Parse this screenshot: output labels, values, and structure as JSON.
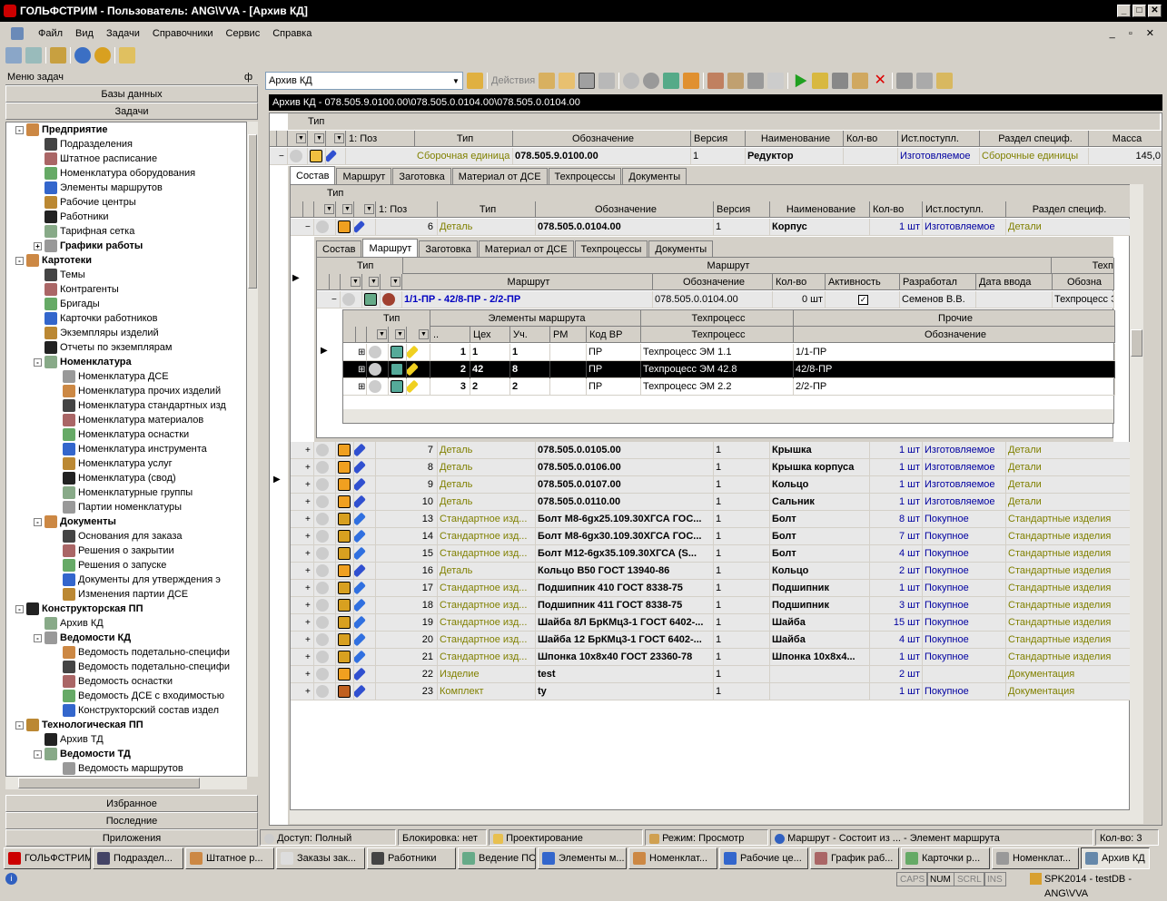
{
  "window": {
    "title": "ГОЛЬФСТРИМ - Пользователь: ANG\\VVA - [Архив КД]",
    "mdi": "_ ▫ ✕"
  },
  "menu": [
    "Файл",
    "Вид",
    "Задачи",
    "Справочники",
    "Сервис",
    "Справка"
  ],
  "left": {
    "header": "Меню задач",
    "pin": "ф",
    "sections_top": [
      "Базы данных",
      "Задачи"
    ],
    "sections_bottom": [
      "Избранное",
      "Последние",
      "Приложения"
    ]
  },
  "tree": [
    {
      "t": "Предприятие",
      "lvl": 1,
      "b": true,
      "pm": "-"
    },
    {
      "t": "Подразделения",
      "lvl": 2
    },
    {
      "t": "Штатное расписание",
      "lvl": 2
    },
    {
      "t": "Номенклатура оборудования",
      "lvl": 2
    },
    {
      "t": "Элементы маршрутов",
      "lvl": 2
    },
    {
      "t": "Рабочие центры",
      "lvl": 2
    },
    {
      "t": "Работники",
      "lvl": 2
    },
    {
      "t": "Тарифная сетка",
      "lvl": 2
    },
    {
      "t": "Графики работы",
      "lvl": 2,
      "b": true,
      "pm": "+"
    },
    {
      "t": "Картотеки",
      "lvl": 1,
      "b": true,
      "pm": "-"
    },
    {
      "t": "Темы",
      "lvl": 2
    },
    {
      "t": "Контрагенты",
      "lvl": 2
    },
    {
      "t": "Бригады",
      "lvl": 2
    },
    {
      "t": "Карточки работников",
      "lvl": 2
    },
    {
      "t": "Экземпляры изделий",
      "lvl": 2
    },
    {
      "t": "Отчеты по экземплярам",
      "lvl": 2
    },
    {
      "t": "Номенклатура",
      "lvl": 2,
      "b": true,
      "pm": "-"
    },
    {
      "t": "Номенклатура ДСЕ",
      "lvl": 3
    },
    {
      "t": "Номенклатура прочих изделий",
      "lvl": 3
    },
    {
      "t": "Номенклатура стандартных изд",
      "lvl": 3
    },
    {
      "t": "Номенклатура материалов",
      "lvl": 3
    },
    {
      "t": "Номенклатура оснастки",
      "lvl": 3
    },
    {
      "t": "Номенклатура инструмента",
      "lvl": 3
    },
    {
      "t": "Номенклатура услуг",
      "lvl": 3
    },
    {
      "t": "Номенклатура (свод)",
      "lvl": 3
    },
    {
      "t": "Номенклатурные группы",
      "lvl": 3
    },
    {
      "t": "Партии номенклатуры",
      "lvl": 3
    },
    {
      "t": "Документы",
      "lvl": 2,
      "b": true,
      "pm": "-"
    },
    {
      "t": "Основания для заказа",
      "lvl": 3
    },
    {
      "t": "Решения о закрытии",
      "lvl": 3
    },
    {
      "t": "Решения о запуске",
      "lvl": 3
    },
    {
      "t": "Документы для утверждения э",
      "lvl": 3
    },
    {
      "t": "Изменения партии ДСЕ",
      "lvl": 3
    },
    {
      "t": "Конструкторская ПП",
      "lvl": 1,
      "b": true,
      "pm": "-"
    },
    {
      "t": "Архив КД",
      "lvl": 2
    },
    {
      "t": "Ведомости КД",
      "lvl": 2,
      "b": true,
      "pm": "-"
    },
    {
      "t": "Ведомость подетально-специфи",
      "lvl": 3
    },
    {
      "t": "Ведомость подетально-специфи",
      "lvl": 3
    },
    {
      "t": "Ведомость оснастки",
      "lvl": 3
    },
    {
      "t": "Ведомость ДСЕ с входимостью",
      "lvl": 3
    },
    {
      "t": "Конструкторский состав издел",
      "lvl": 3
    },
    {
      "t": "Технологическая ПП",
      "lvl": 1,
      "b": true,
      "pm": "-"
    },
    {
      "t": "Архив ТД",
      "lvl": 2
    },
    {
      "t": "Ведомости ТД",
      "lvl": 2,
      "b": true,
      "pm": "-"
    },
    {
      "t": "Ведомость маршрутов",
      "lvl": 3
    }
  ],
  "toolbar2": {
    "combo": "Архив КД",
    "actions": "Действия"
  },
  "path": "Архив КД - 078.505.9.0100.00\\078.505.0.0104.00\\078.505.0.0104.00",
  "grid": {
    "group_label": "Тип",
    "cols": [
      "1: Поз",
      "Тип",
      "Обозначение",
      "Версия",
      "Наименование",
      "Кол-во",
      "Ист.поступл.",
      "Раздел специф.",
      "Масса"
    ],
    "root": {
      "type": "Сборочная единица",
      "code": "078.505.9.0100.00",
      "ver": "1",
      "name": "Редуктор",
      "src": "Изготовляемое",
      "sect": "Сборочные единицы",
      "mass": "145,0"
    },
    "tabs1": [
      "Состав",
      "Маршрут",
      "Заготовка",
      "Материал от ДСЕ",
      "Техпроцессы",
      "Документы"
    ],
    "sub": {
      "group_label": "Тип",
      "cols": [
        "1: Поз",
        "Тип",
        "Обозначение",
        "Версия",
        "Наименование",
        "Кол-во",
        "Ист.поступл.",
        "Раздел специф."
      ],
      "row": {
        "pos": "6",
        "type": "Деталь",
        "code": "078.505.0.0104.00",
        "ver": "1",
        "name": "Корпус",
        "qty": "1 шт",
        "src": "Изготовляемое",
        "sect": "Детали"
      }
    },
    "tabs2": [
      "Состав",
      "Маршрут",
      "Заготовка",
      "Материал от ДСЕ",
      "Техпроцессы",
      "Документы"
    ],
    "route": {
      "group_label": "Тип",
      "band": "Маршрут",
      "band2": "Техп",
      "cols": [
        "Маршрут",
        "Обозначение",
        "Кол-во",
        "Активность",
        "Разработал",
        "Дата ввода",
        "Обозна"
      ],
      "row": {
        "route": "1/1-ПР - 42/8-ПР - 2/2-ПР",
        "code": "078.505.0.0104.00",
        "qty": "0 шт",
        "check": "✓",
        "dev": "Семенов В.В.",
        "tp": "Техпроцесс Э"
      }
    },
    "elements": {
      "group_label": "Тип",
      "band1": "Элементы маршрута",
      "band2": "Техпроцесс",
      "band3": "Прочие",
      "cols": [
        "..",
        "Цех",
        "Уч.",
        "РМ",
        "Код ВР",
        "Техпроцесс",
        "Обозначение"
      ],
      "rows": [
        {
          "n": "1",
          "shop": "1",
          "area": "1",
          "rm": "",
          "vr": "ПР",
          "tp": "Техпроцесс ЭМ 1.1",
          "code": "1/1-ПР"
        },
        {
          "n": "2",
          "shop": "42",
          "area": "8",
          "rm": "",
          "vr": "ПР",
          "tp": "Техпроцесс ЭМ 42.8",
          "code": "42/8-ПР"
        },
        {
          "n": "3",
          "shop": "2",
          "area": "2",
          "rm": "",
          "vr": "ПР",
          "tp": "Техпроцесс ЭМ 2.2",
          "code": "2/2-ПР"
        }
      ]
    },
    "rows": [
      {
        "pos": "7",
        "type": "Деталь",
        "code": "078.505.0.0105.00",
        "ver": "1",
        "name": "Крышка",
        "qty": "1 шт",
        "src": "Изготовляемое",
        "sect": "Детали",
        "k": "d"
      },
      {
        "pos": "8",
        "type": "Деталь",
        "code": "078.505.0.0106.00",
        "ver": "1",
        "name": "Крышка корпуса",
        "qty": "1 шт",
        "src": "Изготовляемое",
        "sect": "Детали",
        "k": "d"
      },
      {
        "pos": "9",
        "type": "Деталь",
        "code": "078.505.0.0107.00",
        "ver": "1",
        "name": "Кольцо",
        "qty": "1 шт",
        "src": "Изготовляемое",
        "sect": "Детали",
        "k": "d"
      },
      {
        "pos": "10",
        "type": "Деталь",
        "code": "078.505.0.0110.00",
        "ver": "1",
        "name": "Сальник",
        "qty": "1 шт",
        "src": "Изготовляемое",
        "sect": "Детали",
        "k": "d"
      },
      {
        "pos": "13",
        "type": "Стандартное изд...",
        "code": "Болт М8-6gx25.109.30ХГСА ГОС...",
        "ver": "1",
        "name": "Болт",
        "qty": "8 шт",
        "src": "Покупное",
        "sect": "Стандартные изделия",
        "k": "s"
      },
      {
        "pos": "14",
        "type": "Стандартное изд...",
        "code": "Болт М8-6gx30.109.30ХГСА ГОС...",
        "ver": "1",
        "name": "Болт",
        "qty": "7 шт",
        "src": "Покупное",
        "sect": "Стандартные изделия",
        "k": "s"
      },
      {
        "pos": "15",
        "type": "Стандартное изд...",
        "code": "Болт М12-6gx35.109.30ХГСА (S...",
        "ver": "1",
        "name": "Болт",
        "qty": "4 шт",
        "src": "Покупное",
        "sect": "Стандартные изделия",
        "k": "s"
      },
      {
        "pos": "16",
        "type": "Деталь",
        "code": "Кольцо В50 ГОСТ 13940-86",
        "ver": "1",
        "name": "Кольцо",
        "qty": "2 шт",
        "src": "Покупное",
        "sect": "Стандартные изделия",
        "k": "d"
      },
      {
        "pos": "17",
        "type": "Стандартное изд...",
        "code": "Подшипник 410 ГОСТ 8338-75",
        "ver": "1",
        "name": "Подшипник",
        "qty": "1 шт",
        "src": "Покупное",
        "sect": "Стандартные изделия",
        "k": "s"
      },
      {
        "pos": "18",
        "type": "Стандартное изд...",
        "code": "Подшипник 411 ГОСТ 8338-75",
        "ver": "1",
        "name": "Подшипник",
        "qty": "3 шт",
        "src": "Покупное",
        "sect": "Стандартные изделия",
        "k": "s"
      },
      {
        "pos": "19",
        "type": "Стандартное изд...",
        "code": "Шайба 8Л БрКМц3-1 ГОСТ 6402-...",
        "ver": "1",
        "name": "Шайба",
        "qty": "15 шт",
        "src": "Покупное",
        "sect": "Стандартные изделия",
        "k": "s"
      },
      {
        "pos": "20",
        "type": "Стандартное изд...",
        "code": "Шайба 12 БрКМц3-1 ГОСТ 6402-...",
        "ver": "1",
        "name": "Шайба",
        "qty": "4 шт",
        "src": "Покупное",
        "sect": "Стандартные изделия",
        "k": "s"
      },
      {
        "pos": "21",
        "type": "Стандартное изд...",
        "code": "Шпонка 10х8х40 ГОСТ 23360-78",
        "ver": "1",
        "name": "Шпонка 10х8х4...",
        "qty": "1 шт",
        "src": "Покупное",
        "sect": "Стандартные изделия",
        "k": "s"
      },
      {
        "pos": "22",
        "type": "Изделие",
        "code": "test",
        "ver": "1",
        "name": "",
        "qty": "2 шт",
        "src": "",
        "sect": "Документация",
        "k": "i"
      },
      {
        "pos": "23",
        "type": "Комплект",
        "code": "ty",
        "ver": "1",
        "name": "",
        "qty": "1 шт",
        "src": "Покупное",
        "sect": "Документация",
        "k": "k"
      }
    ]
  },
  "status": [
    "Доступ: Полный",
    "Блокировка: нет",
    "Проектирование",
    "Режим: Просмотр",
    "Маршрут - Состоит из ... - Элемент маршрута",
    "Кол-во: 3"
  ],
  "tasks": [
    "ГОЛЬФСТРИМ",
    "Подраздел...",
    "Штатное р...",
    "Заказы зак...",
    "Работники",
    "Ведение ПСп",
    "Элементы м...",
    "Номенклат...",
    "Рабочие це...",
    "График раб...",
    "Карточки р...",
    "Номенклат...",
    "Архив КД"
  ],
  "keys": [
    "CAPS",
    "NUM",
    "SCRL",
    "INS"
  ],
  "db": "SPK2014 - testDB - ANG\\VVA"
}
